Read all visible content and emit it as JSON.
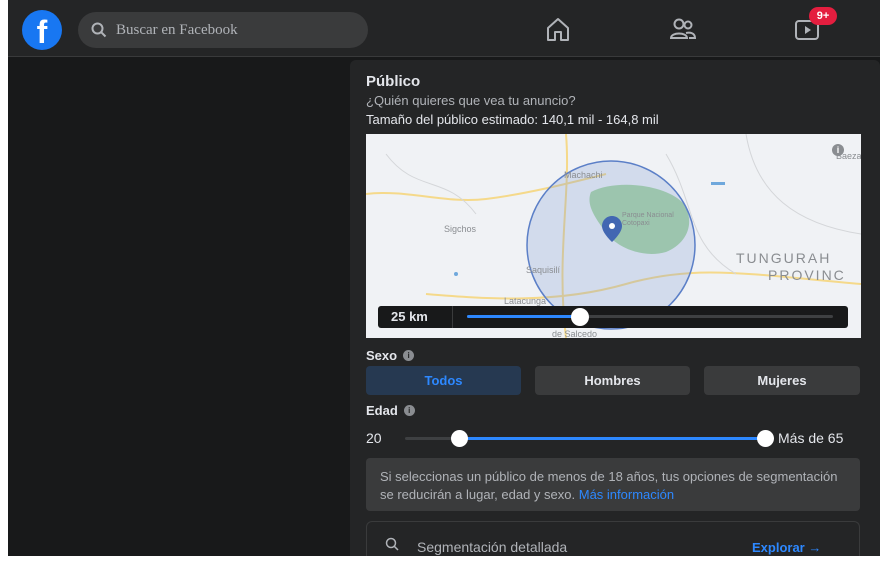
{
  "colors": {
    "background": "#18191a",
    "surface": "#242526",
    "accent": "#2d88ff",
    "brand": "#1877f2",
    "badge": "#e41e3f"
  },
  "topbar": {
    "logo_letter": "f",
    "search_placeholder": "Buscar en Facebook",
    "nav_icons": [
      "home-icon",
      "friends-icon",
      "watch-icon"
    ],
    "watch_badge": "9+"
  },
  "audience": {
    "title": "Público",
    "subtitle": "¿Quién quieres que vea tu anuncio?",
    "size_text": "Tamaño del público estimado: 140,1 mil - 164,8 mil",
    "map": {
      "labels": [
        "Machachi",
        "Sigchos",
        "Parque Nacional Cotopaxi",
        "Saquisilí",
        "Latacunga",
        "de Salcedo",
        "Baeza"
      ],
      "region_line1": "TUNGURAH",
      "region_line2": "PROVINC",
      "radius_label": "25 km",
      "radius_fraction": 0.31
    },
    "gender": {
      "label": "Sexo",
      "options": [
        "Todos",
        "Hombres",
        "Mujeres"
      ],
      "selected": "Todos"
    },
    "age": {
      "label": "Edad",
      "min_label": "20",
      "max_label": "Más de 65",
      "min_fraction": 0.15,
      "max_fraction": 1.0
    },
    "notice": {
      "text": "Si seleccionas un público de menos de 18 años, tus opciones de segmentación se reducirán a lugar, edad y sexo.",
      "link": "Más información"
    },
    "detailed": {
      "label": "Segmentación detallada",
      "action": "Explorar →"
    }
  }
}
